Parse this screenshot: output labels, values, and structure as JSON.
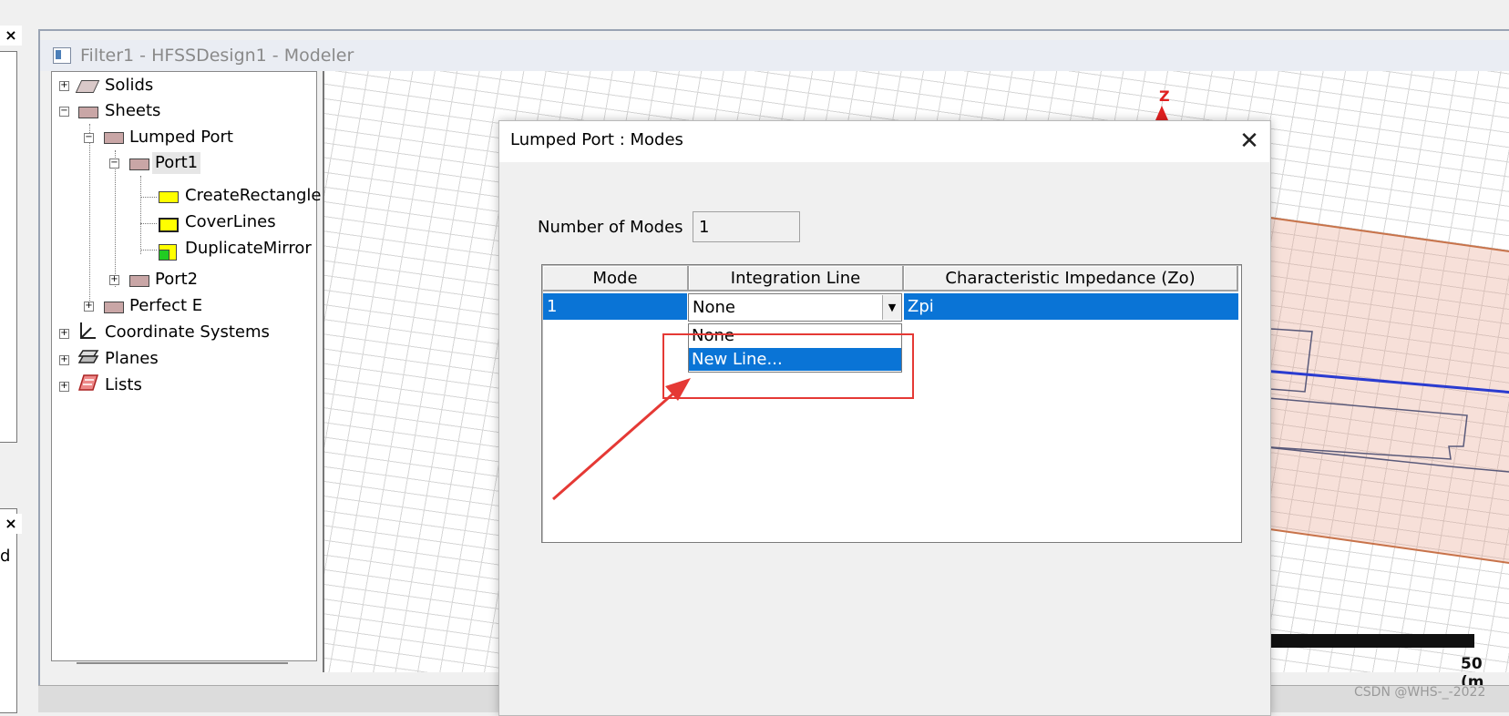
{
  "left_panel": {
    "close1": "×",
    "close2": "×",
    "cut_label": "d"
  },
  "modeler": {
    "title": "Filter1 - HFSSDesign1 - Modeler",
    "tree": [
      {
        "label": "Solids",
        "exp": "+"
      },
      {
        "label": "Sheets",
        "exp": "−"
      },
      {
        "label": "Lumped Port",
        "exp": "−"
      },
      {
        "label": "Port1",
        "exp": "−"
      },
      {
        "label": "CreateRectangle"
      },
      {
        "label": "CoverLines"
      },
      {
        "label": "DuplicateMirror"
      },
      {
        "label": "Port2",
        "exp": "+"
      },
      {
        "label": "Perfect E",
        "exp": "+"
      },
      {
        "label": "Coordinate Systems",
        "exp": "+"
      },
      {
        "label": "Planes",
        "exp": "+"
      },
      {
        "label": "Lists",
        "exp": "+"
      }
    ],
    "axis_label": "Z",
    "scale_label": "50 (m",
    "watermark": "CSDN @WHS-_-2022"
  },
  "dialog": {
    "title": "Lumped Port : Modes",
    "close": "✕",
    "modes_label": "Number of Modes",
    "modes_value": "1",
    "columns": [
      "Mode",
      "Integration Line",
      "Characteristic Impedance (Zo)"
    ],
    "row": {
      "mode": "1",
      "integration_line": "None",
      "impedance": "Zpi"
    },
    "combo_arrow": "▼",
    "dropdown_options": [
      "None",
      "New Line..."
    ]
  },
  "colors": {
    "selection": "#0a74d6",
    "highlight": "#e53935"
  }
}
